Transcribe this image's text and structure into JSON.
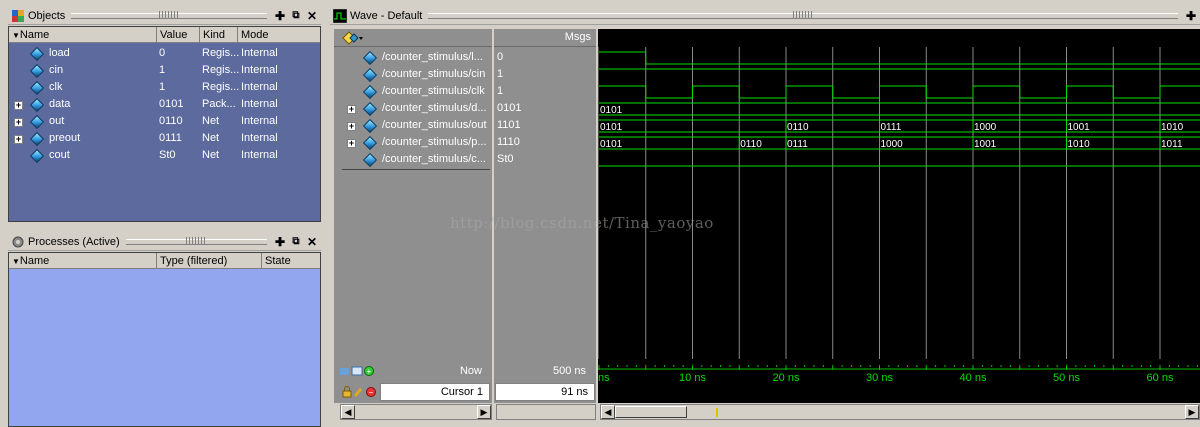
{
  "objects_pane": {
    "title": "Objects",
    "columns": [
      "Name",
      "Value",
      "Kind",
      "Mode"
    ],
    "rows": [
      {
        "name": "load",
        "value": "0",
        "kind": "Regis...",
        "mode": "Internal",
        "expandable": false
      },
      {
        "name": "cin",
        "value": "1",
        "kind": "Regis...",
        "mode": "Internal",
        "expandable": false
      },
      {
        "name": "clk",
        "value": "1",
        "kind": "Regis...",
        "mode": "Internal",
        "expandable": false
      },
      {
        "name": "data",
        "value": "0101",
        "kind": "Pack...",
        "mode": "Internal",
        "expandable": true
      },
      {
        "name": "out",
        "value": "0110",
        "kind": "Net",
        "mode": "Internal",
        "expandable": true
      },
      {
        "name": "preout",
        "value": "0111",
        "kind": "Net",
        "mode": "Internal",
        "expandable": true
      },
      {
        "name": "cout",
        "value": "St0",
        "kind": "Net",
        "mode": "Internal",
        "expandable": false
      }
    ]
  },
  "processes_pane": {
    "title": "Processes (Active)",
    "columns": [
      "Name",
      "Type (filtered)",
      "State"
    ]
  },
  "wave_window": {
    "title": "Wave - Default",
    "msgs_label": "Msgs",
    "signals": [
      {
        "name": "/counter_stimulus/l...",
        "value": "0",
        "expandable": false
      },
      {
        "name": "/counter_stimulus/cin",
        "value": "1",
        "expandable": false
      },
      {
        "name": "/counter_stimulus/clk",
        "value": "1",
        "expandable": false
      },
      {
        "name": "/counter_stimulus/d...",
        "value": "0101",
        "expandable": true
      },
      {
        "name": "/counter_stimulus/out",
        "value": "1101",
        "expandable": true
      },
      {
        "name": "/counter_stimulus/p...",
        "value": "1110",
        "expandable": true
      },
      {
        "name": "/counter_stimulus/c...",
        "value": "St0",
        "expandable": false
      }
    ],
    "now_label": "Now",
    "now_value": "500 ns",
    "cursor_label": "Cursor 1",
    "cursor_value": "91 ns",
    "time_axis": [
      "ns",
      "10 ns",
      "20 ns",
      "30 ns",
      "40 ns",
      "50 ns",
      "60 ns"
    ],
    "wave_color": "#00e000",
    "bus_data": {
      "value": "0101"
    },
    "bus_out": [
      "0101",
      "0110",
      "0111",
      "1000",
      "1001",
      "1010"
    ],
    "bus_preout": [
      "0101",
      "0110",
      "0111",
      "1000",
      "1001",
      "1010",
      "1011"
    ]
  },
  "watermark": "http://blog.csdn.net/Tina_yaoyao",
  "icons": {
    "objects": "objects-icon",
    "processes": "gear-icon",
    "wave": "wave-icon",
    "pin": "pin-icon",
    "undock": "undock-icon",
    "close": "close-icon"
  }
}
